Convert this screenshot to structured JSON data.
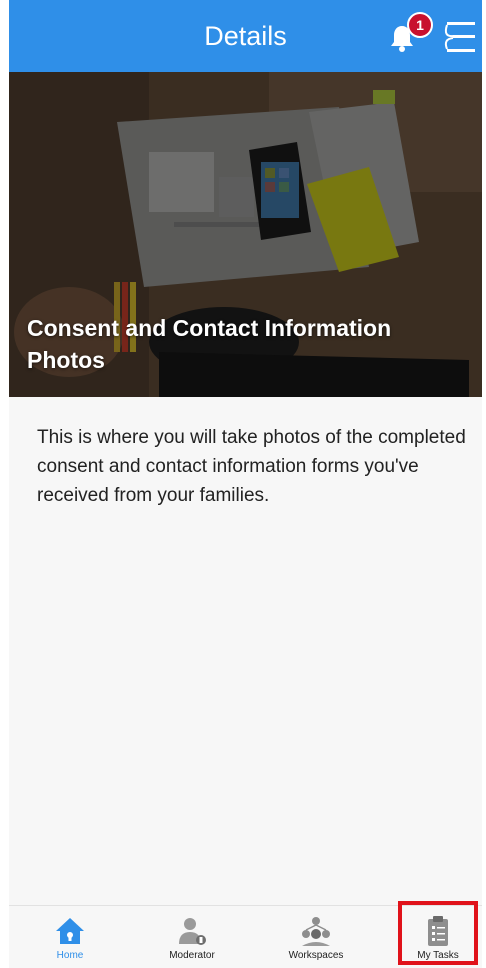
{
  "header": {
    "title": "Details",
    "notification_count": "1",
    "bell_icon": "bell-icon",
    "menu_icon": "menu-icon"
  },
  "hero": {
    "title": "Consent and Contact Information Photos"
  },
  "content": {
    "description": "This is where you will take photos of the completed consent and contact information forms you've received from your families."
  },
  "tabbar": {
    "tabs": [
      {
        "label": "Home",
        "icon": "home-icon",
        "active": true
      },
      {
        "label": "Moderator",
        "icon": "moderator-icon",
        "active": false
      },
      {
        "label": "Workspaces",
        "icon": "workspaces-icon",
        "active": false
      },
      {
        "label": "My Tasks",
        "icon": "clipboard-icon",
        "active": false
      }
    ]
  },
  "colors": {
    "header_bg": "#2f8fe8",
    "badge": "#c8102e",
    "highlight": "#e0121a",
    "active_tab": "#2f8fe8"
  }
}
